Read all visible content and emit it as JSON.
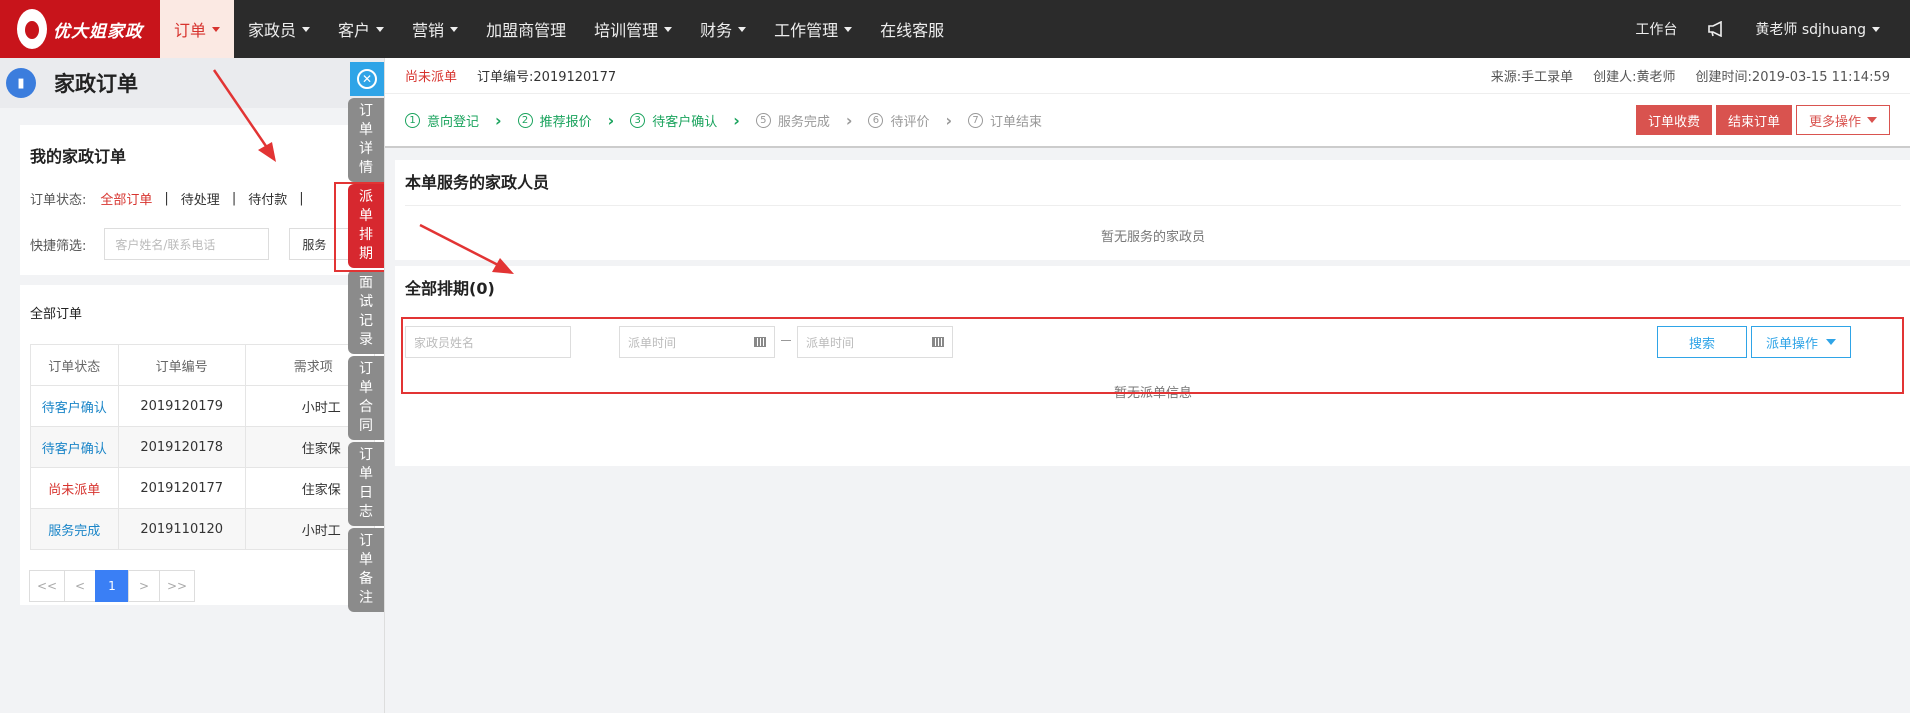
{
  "nav": {
    "logo_text": "优大姐家政",
    "items": [
      "订单",
      "家政员",
      "客户",
      "营销",
      "加盟商管理",
      "培训管理",
      "财务",
      "工作管理",
      "在线客服"
    ],
    "right": {
      "workbench": "工作台",
      "user": "黄老师 sdjhuang"
    }
  },
  "left": {
    "page_title": "家政订单",
    "my_orders": "我的家政订单",
    "status_label": "订单状态:",
    "statuses": [
      "全部订单",
      "待处理",
      "待付款"
    ],
    "quick_label": "快捷筛选:",
    "search_placeholder": "客户姓名/联系电话",
    "service_btn": "服务",
    "all_orders": "全部订单",
    "table": {
      "headers": [
        "订单状态",
        "订单编号",
        "需求项"
      ],
      "rows": [
        {
          "status": "待客户确认",
          "no": "2019120179",
          "need": "小时工"
        },
        {
          "status": "待客户确认",
          "no": "2019120178",
          "need": "住家保"
        },
        {
          "status": "尚未派单",
          "no": "2019120177",
          "need": "住家保"
        },
        {
          "status": "服务完成",
          "no": "2019110120",
          "need": "小时工"
        }
      ]
    },
    "pager": [
      "<<",
      "<",
      "1",
      ">",
      ">>"
    ]
  },
  "vtabs": [
    "订单详情",
    "派单排期",
    "面试记录",
    "订单合同",
    "订单日志",
    "订单备注"
  ],
  "detail": {
    "status": "尚未派单",
    "order_no": "订单编号:2019120177",
    "source": "来源:手工录单",
    "creator": "创建人:黄老师",
    "created": "创建时间:2019-03-15 11:14:59",
    "steps": [
      {
        "num": "1",
        "label": "意向登记"
      },
      {
        "num": "2",
        "label": "推荐报价"
      },
      {
        "num": "3",
        "label": "待客户确认"
      },
      {
        "num": "5",
        "label": "服务完成"
      },
      {
        "num": "6",
        "label": "待评价"
      },
      {
        "num": "7",
        "label": "订单结束"
      }
    ],
    "actions": [
      "订单收费",
      "结束订单",
      "更多操作"
    ],
    "staff_title": "本单服务的家政人员",
    "staff_empty": "暂无服务的家政员",
    "schedule_title": "全部排期(0)",
    "name_placeholder": "家政员姓名",
    "time_placeholder": "派单时间",
    "search_btn": "搜索",
    "dispatch_btn": "派单操作",
    "schedule_empty": "暂无派单信息"
  },
  "colors": {
    "brand_red": "#c8141b",
    "accent_blue": "#2fa4e7",
    "step_green": "#1aa35d",
    "annotation_red": "#e23434"
  }
}
